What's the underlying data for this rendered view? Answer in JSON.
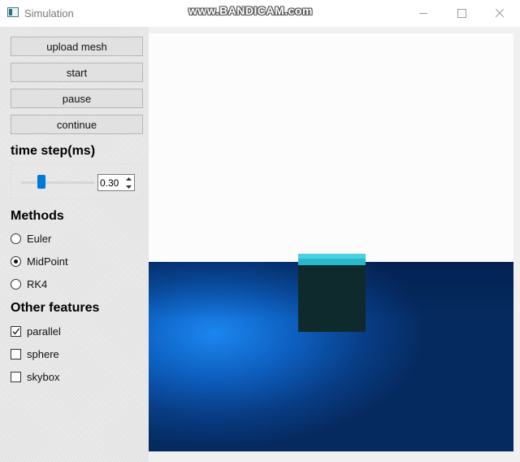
{
  "window": {
    "title": "Simulation",
    "watermark": "www.BANDICAM.com"
  },
  "controls": {
    "upload_label": "upload mesh",
    "start_label": "start",
    "pause_label": "pause",
    "continue_label": "continue"
  },
  "time_step": {
    "heading": "time step(ms)",
    "value": "0.30",
    "slider_fraction": 0.25
  },
  "methods": {
    "heading": "Methods",
    "options": [
      {
        "label": "Euler",
        "checked": false
      },
      {
        "label": "MidPoint",
        "checked": true
      },
      {
        "label": "RK4",
        "checked": false
      }
    ]
  },
  "features": {
    "heading": "Other features",
    "options": [
      {
        "label": "parallel",
        "checked": true
      },
      {
        "label": "sphere",
        "checked": false
      },
      {
        "label": "skybox",
        "checked": false
      }
    ]
  },
  "colors": {
    "accent": "#0078d7",
    "floor": "#0d5fbf",
    "cube_top": "#27b8cc",
    "cube_side": "#0f2a2c"
  },
  "icons": {
    "minimize": "minimize-icon",
    "maximize": "maximize-icon",
    "close": "close-icon"
  }
}
